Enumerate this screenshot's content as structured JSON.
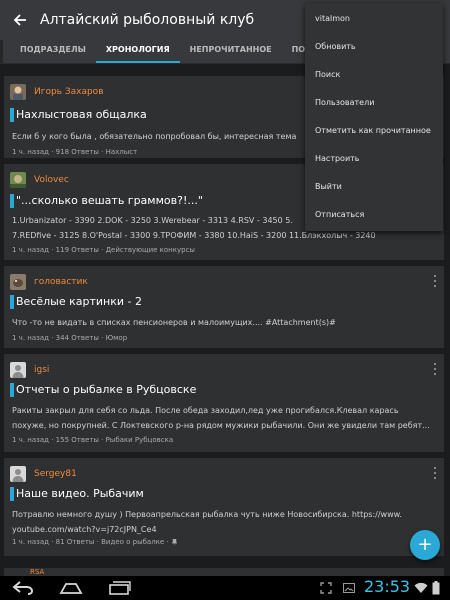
{
  "appbar": {
    "title": "Алтайский рыболовный клуб",
    "back_icon": "arrow-left-icon"
  },
  "tabs": [
    {
      "label": "ПОДРАЗДЕЛЫ"
    },
    {
      "label": "ХРОНОЛОГИЯ",
      "active": true
    },
    {
      "label": "НЕПРОЧИТАННОЕ"
    },
    {
      "label": "ПОДПИСКИ"
    }
  ],
  "posts": [
    {
      "author": "Игорь Захаров",
      "title": "Нахлыстовая общалка",
      "body": [
        "Если б у кого была , обязательно попробовал бы, интересная тема"
      ],
      "time": "1 ч. назад",
      "replies": "918 Ответы",
      "category": "Нахлыст"
    },
    {
      "author": "Volovec",
      "title": "\"...сколько вешать граммов?!...\"",
      "body": [
        "1.Urbanizator - 3390 2.DOK - 3250 3.Werebear - 3313 4.RSV - 3450 5.",
        "7.REDfive - 3125 8.O'Postal - 3300 9.ТРОФИМ - 3380 10.HaiS - 3200 11.Блэкхолыч - 3240"
      ],
      "time": "1 ч. назад",
      "replies": "119 Ответы",
      "category": "Действующие конкурсы"
    },
    {
      "author": "головастик",
      "title": "Весёлые картинки - 2",
      "body": [
        "Что -то не видать в списках пенсионеров и малоимущих....  #Attachment(s)#"
      ],
      "time": "1 ч. назад",
      "replies": "344 Ответы",
      "category": "Юмор"
    },
    {
      "author": "igsi",
      "title": "Отчеты о рыбалке в Рубцовске",
      "body": [
        "Ракиты закрыл для себя со льда. После обеда заходил,лед уже прогибался.Клевал карась",
        "похуже, но покрупней. С Локтевского р-на рядом мужики рыбачили. Они же увидели там ребят..."
      ],
      "time": "1 ч. назад",
      "replies": "155 Ответы",
      "category": "Рыбаки Рубцовска"
    },
    {
      "author": "Sergey81",
      "title": "Наше видео. Рыбачим",
      "body": [
        "Потравлю немного душу ) Первоапрельская рыбалка чуть ниже Новосибирска. https://www.",
        "youtube.com/watch?v=j72cJPN_Ce4"
      ],
      "time": "1 ч. назад",
      "replies": "81 Ответы",
      "category": "Видео о рыбалке"
    }
  ],
  "next_author_peek": "RSA",
  "menu": {
    "items": [
      "vitalmon",
      "Обновить",
      "Поиск",
      "Пользователи",
      "Отметить как прочитанное",
      "Настроить",
      "Выйти",
      "Отписаться"
    ]
  },
  "fab": {
    "label": "+",
    "icon": "plus-icon"
  },
  "statusbar": {
    "time": "23:53"
  },
  "colors": {
    "accent": "#2aa9d6",
    "author": "#f08a3c",
    "card": "#2f3032",
    "background": "#1b1c1e"
  }
}
